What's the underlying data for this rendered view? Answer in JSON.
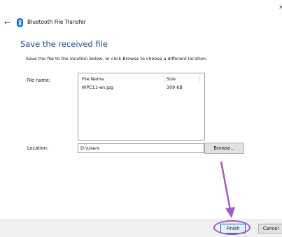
{
  "window": {
    "title": "Bluetooth File Transfer",
    "close_glyph": "×",
    "back_glyph": "←"
  },
  "page": {
    "heading": "Save the received file",
    "instructions": "Save the file to the location below, or click Browse to choose a different location."
  },
  "form": {
    "file_name_label": "File name:",
    "location_label": "Location:",
    "location_value": "D:\\Users",
    "browse_label": "Browse..."
  },
  "file_list": {
    "columns": [
      "File Name",
      "Size"
    ],
    "rows": [
      {
        "name": "WPC11-en.jpg",
        "size": "309 KB"
      }
    ]
  },
  "footer": {
    "finish_label": "Finish",
    "cancel_label": "Cancel"
  },
  "colors": {
    "heading": "#1a4f9c",
    "accent": "#0a64d8",
    "annotation": "#a259c4"
  }
}
